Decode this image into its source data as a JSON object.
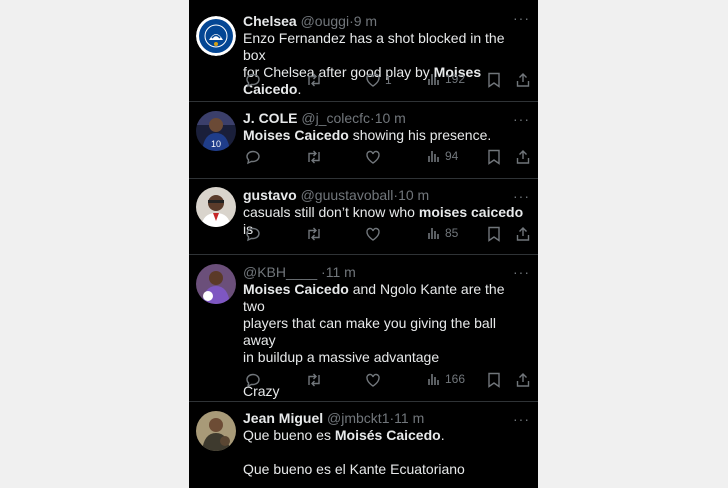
{
  "tweets": [
    {
      "name": "Chelsea",
      "handle": "@ouggi",
      "dot": "·",
      "time": "9 m",
      "line1": "Enzo Fernandez has a shot blocked in the box",
      "line2a": "for Chelsea after good play by ",
      "line2b": "Moises Caicedo",
      "line2c": ".",
      "likes": "1",
      "views": "192",
      "avatar": "chelsea-crest"
    },
    {
      "name": "J. COLE",
      "handle": "@j_colecfc",
      "dot": "·",
      "time": "10 m",
      "bold": "Moises Caicedo",
      "rest": " showing his presence.",
      "views": "94",
      "avatar": "player-photo"
    },
    {
      "name": "gustavo",
      "handle": "@guustavoball",
      "dot": "·",
      "time": "10 m",
      "pre": "casuals still don’t know who ",
      "bold": "moises caicedo",
      "post": " is",
      "views": "85",
      "avatar": "person-photo"
    },
    {
      "handle": "@KBH____",
      "dot": "·",
      "time": "11 m",
      "bold": "Moises Caicedo",
      "rest1": " and Ngolo Kante are the two",
      "line2": "players that can make you giving the ball away",
      "line3": "in buildup a massive advantage",
      "line4": "Crazy",
      "views": "166",
      "avatar": "person-photo"
    },
    {
      "name": "Jean Miguel",
      "handle": "@jmbckt1",
      "dot": "·",
      "time": "11 m",
      "pre": "Que bueno es ",
      "bold": "Moisés Caicedo",
      "post": ".",
      "line2": "Que bueno es el Kante Ecuatoriano",
      "avatar": "person-photo"
    }
  ],
  "more_label": "···",
  "colors": {
    "background": "#000000",
    "text": "#e7e9ea",
    "muted": "#71767b",
    "divider": "#2f3336"
  }
}
